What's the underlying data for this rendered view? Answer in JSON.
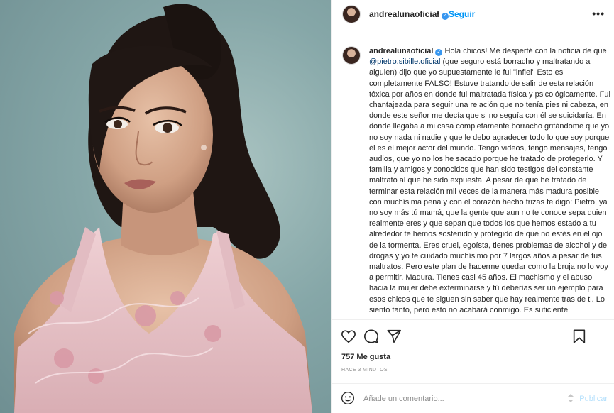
{
  "post": {
    "username": "andrealunaoficial",
    "verified_badge": "✓",
    "dot": "•",
    "follow_label": "Seguir",
    "more_icon": "more-dots-icon"
  },
  "caption": {
    "username": "andrealunaoficial",
    "part1": " Hola chicos! Me desperté con la noticia de que ",
    "mention": "@pietro.sibille.oficial",
    "part2": " (que seguro está borracho y maltratando a alguien) dijo que yo supuestamente le fui \"infiel\" Esto es completamente FALSO! Estuve tratando de salir de esta relación tóxica por años en donde fui maltratada física y psicológicamente. Fui chantajeada para seguir una relación que no tenía pies ni cabeza, en donde este señor me decía que si no seguía con él se suicidaría. En donde llegaba a mi casa completamente borracho gritándome que yo no soy nada ni nadie y que le debo agradecer todo lo que soy porque él es el mejor actor del mundo. Tengo videos, tengo mensajes, tengo audios, que yo no los he sacado porque he tratado de protegerlo. Y familia y amigos y conocidos que han sido testigos del constante maltrato al que he sido expuesta. A pesar de que he tratado de terminar esta relación mil veces de la manera más madura posible con muchísima pena y con el corazón hecho trizas te digo: Pietro, ya no soy más tú mamá, que la gente que aun no te conoce sepa quien realmente eres y que sepan que todos los que hemos estado a tu alrededor te hemos sostenido y protegido de que no estés en el ojo de la tormenta. Eres cruel, egoísta, tienes problemas de alcohol y de drogas y yo te cuidado muchísimo por 7 largos años a pesar de tus maltratos. Pero este plan de hacerme quedar como la bruja no lo voy a permitir. Madura. Tienes casi 45 años. El machismo y el abuso hacia la mujer debe exterminarse y tú deberías ser un ejemplo para esos chicos que te siguen sin saber que hay realmente tras de ti. Lo siento tanto, pero esto no acabará conmigo. Es suficiente."
  },
  "actions": {
    "like_icon": "heart-icon",
    "comment_icon": "comment-icon",
    "share_icon": "share-icon",
    "save_icon": "bookmark-icon"
  },
  "stats": {
    "likes": "757 Me gusta",
    "time_ago": "HACE 3 MINUTOS"
  },
  "comment": {
    "emoji_icon": "emoji-icon",
    "placeholder": "Añade un comentario...",
    "publish_label": "Publicar"
  },
  "colors": {
    "accent": "#0095f6",
    "verified": "#3897f0",
    "mention": "#00376b",
    "publish_disabled": "#b2dffc",
    "photo_background": "#86a7a8",
    "dress": "#e9c3c8"
  }
}
